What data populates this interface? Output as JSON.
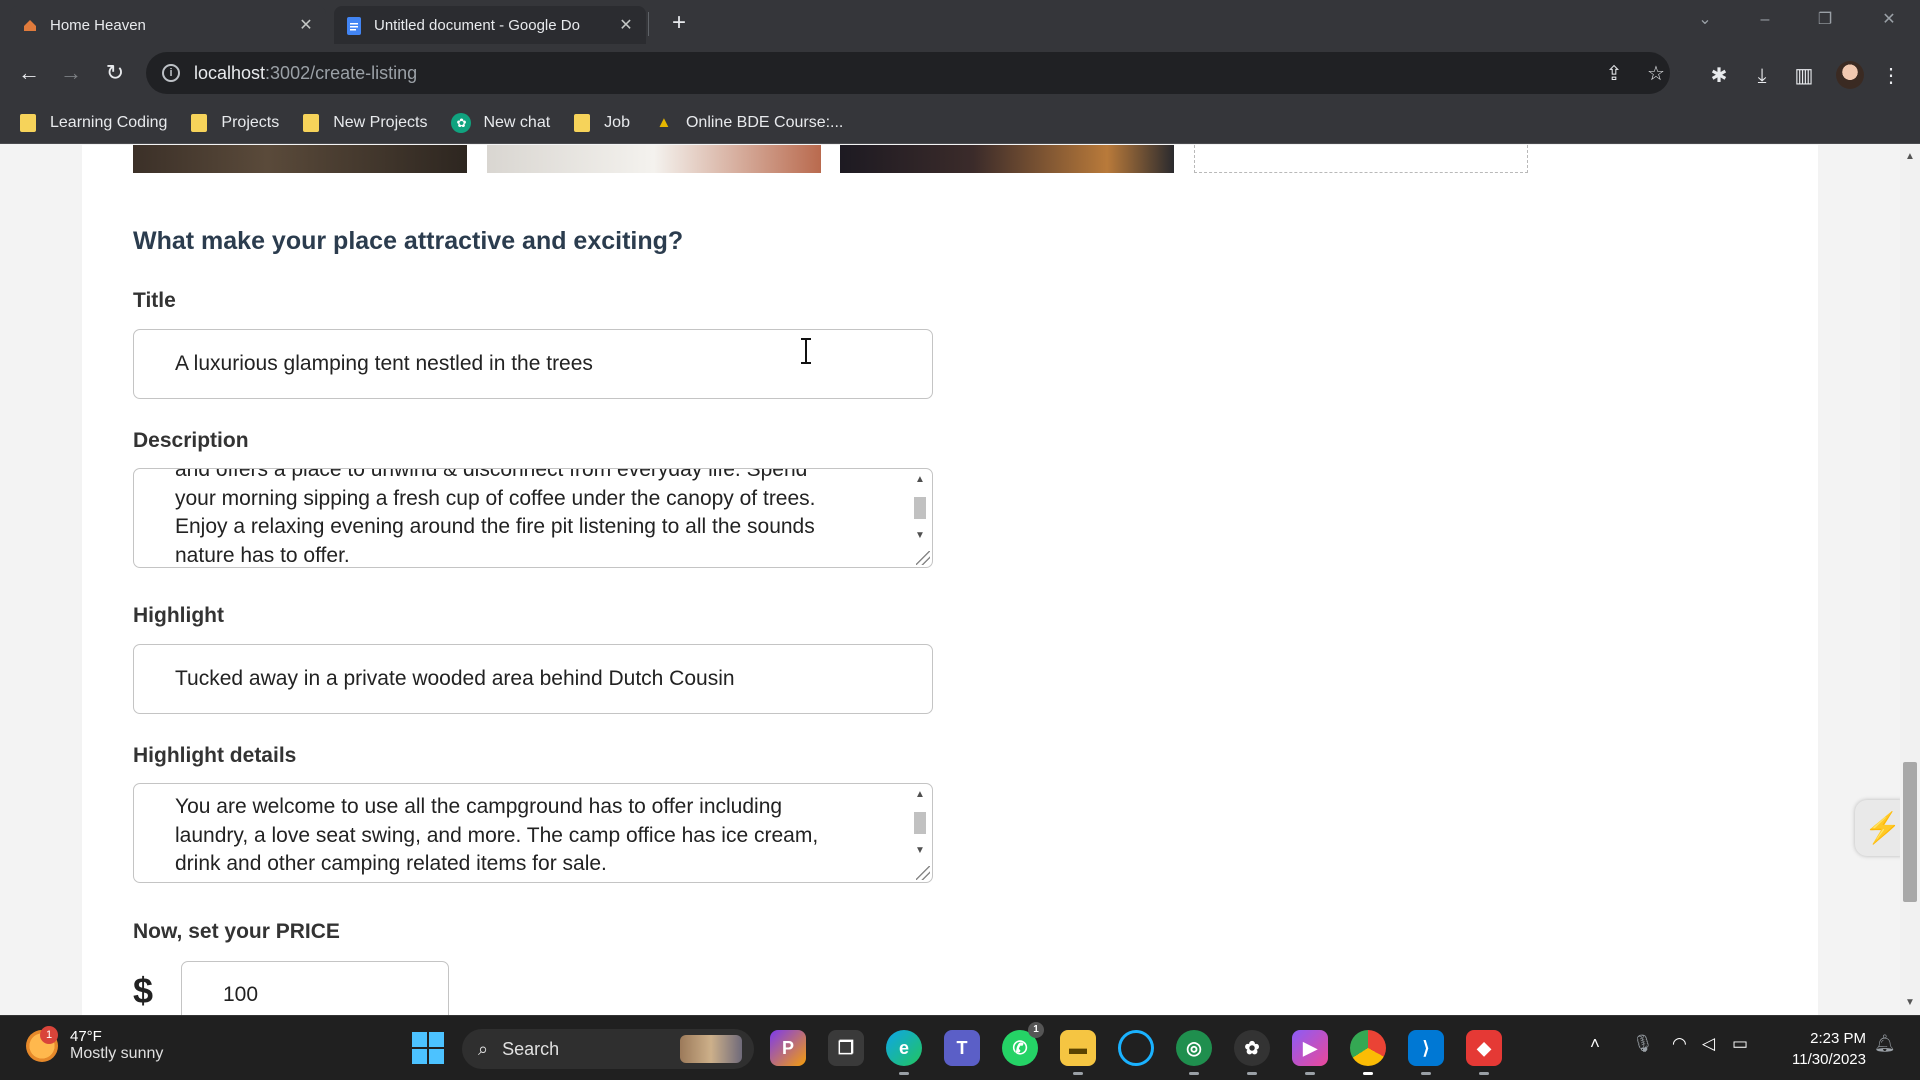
{
  "browser": {
    "tabs": [
      {
        "title": "Home Heaven",
        "active": true,
        "favicon": "home-heaven-favicon"
      },
      {
        "title": "Untitled document - Google Do",
        "active": false,
        "favicon": "google-docs-icon"
      }
    ],
    "url": {
      "host": "localhost",
      "path": ":3002/create-listing"
    },
    "bookmarks": [
      {
        "label": "Learning Coding",
        "icon": "folder-icon"
      },
      {
        "label": "Projects",
        "icon": "folder-icon"
      },
      {
        "label": "New Projects",
        "icon": "folder-icon"
      },
      {
        "label": "New chat",
        "icon": "chatgpt-icon"
      },
      {
        "label": "Job",
        "icon": "folder-icon"
      },
      {
        "label": "Online BDE Course:...",
        "icon": "course-icon"
      }
    ]
  },
  "form": {
    "question": "What make your place attractive and exciting?",
    "title_label": "Title",
    "title_value": "A luxurious glamping tent nestled in the trees",
    "description_label": "Description",
    "description_lines": [
      "and offers a place to unwind & disconnect from everyday life. Spend",
      "your morning sipping a fresh cup of coffee under the canopy of trees.",
      "Enjoy a relaxing evening around the fire pit listening to all the sounds",
      "nature has to offer."
    ],
    "highlight_label": "Highlight",
    "highlight_value": "Tucked away in a private wooded area behind Dutch Cousin",
    "highlight_details_label": "Highlight details",
    "highlight_details_lines": [
      "You are welcome to use all the campground has to offer including",
      "laundry, a love seat swing, and more. The camp office has ice cream,",
      "drink and other camping related items for sale."
    ],
    "price_label": "Now, set your PRICE",
    "currency": "$",
    "price_value": "100"
  },
  "taskbar": {
    "weather_temp": "47°F",
    "weather_desc": "Mostly sunny",
    "weather_badge": "1",
    "search_label": "Search",
    "teams_badge": "1",
    "time": "2:23 PM",
    "date": "11/30/2023"
  },
  "colors": {
    "chrome_dark": "#35363a",
    "heading": "#2b3c4e",
    "field_border": "#c4c4c4",
    "windows_accent": "#4cc2ff"
  }
}
